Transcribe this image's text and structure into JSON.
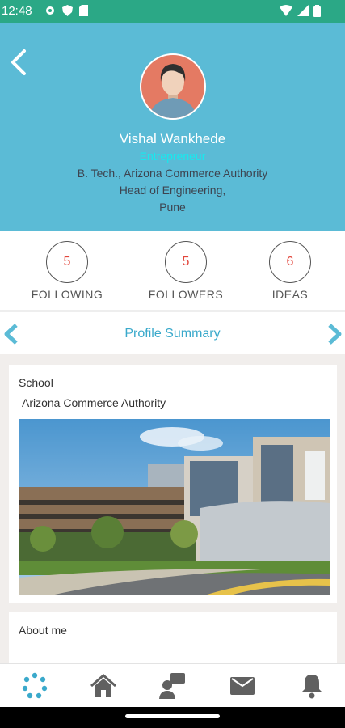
{
  "status_bar": {
    "time": "12:48"
  },
  "profile": {
    "name": "Vishal Wankhede",
    "role": "Entrepreneur",
    "education": "B. Tech., Arizona Commerce Authority",
    "position": "Head of Engineering,",
    "location": "Pune"
  },
  "stats": [
    {
      "value": "5",
      "label": "FOLLOWING"
    },
    {
      "value": "5",
      "label": "FOLLOWERS"
    },
    {
      "value": "6",
      "label": "IDEAS"
    }
  ],
  "summary": {
    "title": "Profile Summary"
  },
  "school_card": {
    "label": "School",
    "value": "Arizona Commerce Authority"
  },
  "about_card": {
    "label": "About me"
  },
  "colors": {
    "header": "#5bbbd6",
    "status_bar": "#2ba886",
    "accent": "#3aa9cb",
    "role": "#19e8ee",
    "stat_value": "#e2463c"
  },
  "icons": [
    "back-icon",
    "avatar-icon",
    "chevron-left-icon",
    "chevron-right-icon",
    "dots-icon",
    "home-icon",
    "contacts-icon",
    "mail-icon",
    "bell-icon"
  ]
}
